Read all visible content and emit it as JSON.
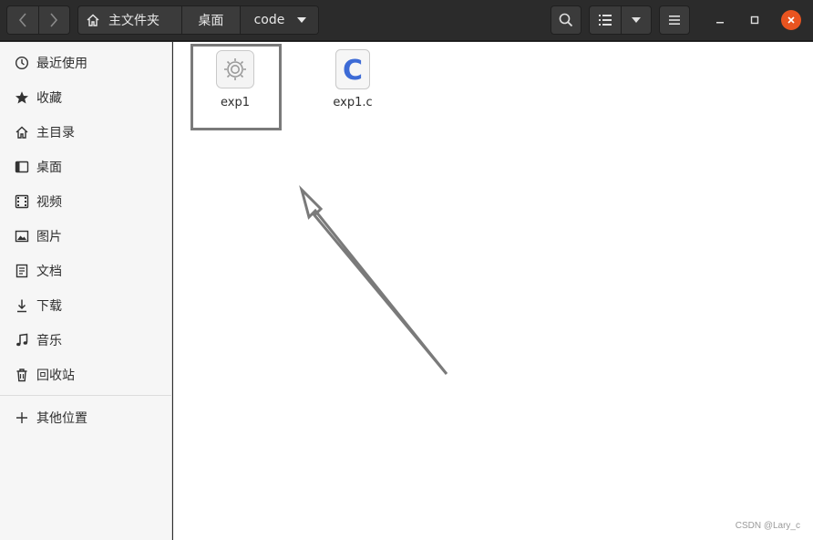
{
  "breadcrumb": {
    "home_label": "主文件夹",
    "desktop_label": "桌面",
    "current_label": "code"
  },
  "sidebar": {
    "items": [
      {
        "label": "最近使用",
        "icon": "clock-icon"
      },
      {
        "label": "收藏",
        "icon": "star-icon"
      },
      {
        "label": "主目录",
        "icon": "home-icon"
      },
      {
        "label": "桌面",
        "icon": "desktop-icon"
      },
      {
        "label": "视频",
        "icon": "film-icon"
      },
      {
        "label": "图片",
        "icon": "image-icon"
      },
      {
        "label": "文档",
        "icon": "document-icon"
      },
      {
        "label": "下载",
        "icon": "download-icon"
      },
      {
        "label": "音乐",
        "icon": "music-icon"
      },
      {
        "label": "回收站",
        "icon": "trash-icon"
      }
    ],
    "other_locations": {
      "label": "其他位置",
      "icon": "plus-icon"
    }
  },
  "files": [
    {
      "name": "exp1",
      "type": "executable",
      "icon": "gear-icon",
      "selected": true
    },
    {
      "name": "exp1.c",
      "type": "c-source",
      "icon": "c-letter-icon",
      "glyph": "C"
    }
  ],
  "watermark": "CSDN @Lary_c",
  "colors": {
    "headerbar": "#2b2b2b",
    "accent_close": "#e95420",
    "c_icon_blue": "#3d6bd6",
    "annotation_gray": "#7a7a7a"
  }
}
